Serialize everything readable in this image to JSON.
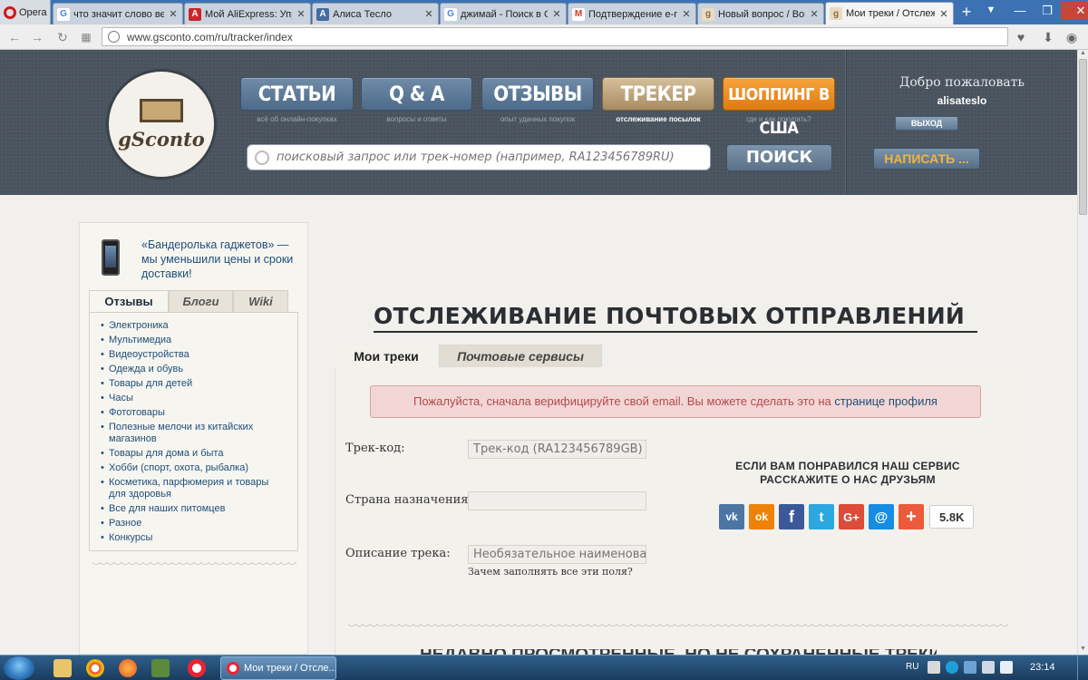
{
  "browser": {
    "menu_label": "Opera",
    "tabs": [
      {
        "title": "что значит слово вер",
        "favicon": "G",
        "color": "#4285f4"
      },
      {
        "title": "Мой AliExpress: Управ",
        "favicon": "A",
        "color": "#c9252c"
      },
      {
        "title": "Алиса Тесло",
        "favicon": "A",
        "color": "#466ba0"
      },
      {
        "title": "джимай - Поиск в G",
        "favicon": "G",
        "color": "#4285f4"
      },
      {
        "title": "Подтверждение e-m",
        "favicon": "M",
        "color": "#d93025"
      },
      {
        "title": "Новый вопрос / Воп",
        "favicon": "g",
        "color": "#8b6b3f"
      },
      {
        "title": "Мои треки / Отслеж",
        "favicon": "g",
        "color": "#8b6b3f"
      }
    ],
    "url": "www.gsconto.com/ru/tracker/index"
  },
  "header": {
    "logo_text": "gSconto",
    "nav": [
      {
        "label": "СТАТЬИ",
        "sub": "всё об онлайн-покупках"
      },
      {
        "label": "Q & A",
        "sub": "вопросы и ответы"
      },
      {
        "label": "ОТЗЫВЫ",
        "sub": "опыт удачных покупок"
      },
      {
        "label": "ТРЕКЕР",
        "sub": "отслеживание посылок"
      },
      {
        "label": "ШОППИНГ В США",
        "sub": "где и как покупать?"
      }
    ],
    "search_placeholder": "поисковый запрос или трек-номер (например, RA123456789RU)",
    "search_button": "ПОИСК",
    "welcome": "Добро пожаловать",
    "username": "alisateslo",
    "logout": "ВЫХОД",
    "write": "НАПИСАТЬ ..."
  },
  "sidebar": {
    "promo": "«Бандеролька гаджетов» — мы уменьшили цены и сроки доставки!",
    "tabs": [
      "Отзывы",
      "Блоги",
      "Wiki"
    ],
    "categories": [
      "Электроника",
      "Мультимедиа",
      "Видеоустройства",
      "Одежда и обувь",
      "Товары для детей",
      "Часы",
      "Фототовары",
      "Полезные мелочи из китайских магазинов",
      "Товары для дома и быта",
      "Хобби (спорт, охота, рыбалка)",
      "Косметика, парфюмерия и товары для здоровья",
      "Все для наших питомцев",
      "Разное",
      "Конкурсы"
    ]
  },
  "main": {
    "title": "ОТСЛЕЖИВАНИЕ ПОЧТОВЫХ ОТПРАВЛЕНИЙ",
    "tabs": [
      "Мои треки",
      "Почтовые сервисы"
    ],
    "alert_text": "Пожалуйста, сначала верифицируйте свой email. Вы можете сделать это на ",
    "alert_link": "странице профиля",
    "form": {
      "track_label": "Трек-код:",
      "track_placeholder": "Трек-код (RA123456789GB)",
      "country_label": "Страна назначения:",
      "country_value": "",
      "desc_label": "Описание трека:",
      "desc_placeholder": "Необязательное наименование",
      "why_link": "Зачем заполнять все эти поля?"
    },
    "share_title": "ЕСЛИ ВАМ ПОНРАВИЛСЯ НАШ СЕРВИС РАССКАЖИТЕ О НАС ДРУЗЬЯМ",
    "social": [
      {
        "name": "vk-icon",
        "glyph": "vk",
        "color": "#4c75a3"
      },
      {
        "name": "odnoklassniki-icon",
        "glyph": "ok",
        "color": "#ee8208"
      },
      {
        "name": "facebook-icon",
        "glyph": "f",
        "color": "#3b5998"
      },
      {
        "name": "twitter-icon",
        "glyph": "t",
        "color": "#2ca7e0"
      },
      {
        "name": "google-plus-icon",
        "glyph": "G+",
        "color": "#dd4b39"
      },
      {
        "name": "moimir-icon",
        "glyph": "@",
        "color": "#168de2"
      },
      {
        "name": "share-more-icon",
        "glyph": "+",
        "color": "#ec5a3c"
      }
    ],
    "share_count": "5.8K",
    "bottom_heading": "НЕДАВНО ПРОСМОТРЕННЫЕ, НО НЕ СОХРАНЕННЫЕ ТРЕКИ"
  },
  "taskbar": {
    "task_title": "Мои треки / Отсле...",
    "lang": "RU",
    "time": "23:14"
  }
}
